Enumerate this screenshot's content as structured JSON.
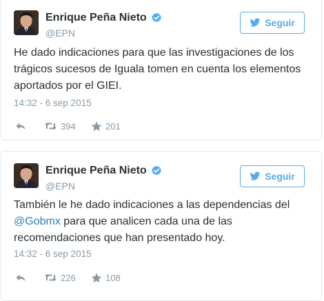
{
  "tweets": [
    {
      "author": {
        "name": "Enrique Peña Nieto",
        "handle": "@EPN",
        "verified": true
      },
      "follow_label": "Seguir",
      "text_before": "He dado indicaciones para que las investigaciones de los trágicos sucesos de Iguala tomen en cuenta los elementos aportados por el GIEI.",
      "mention": "",
      "text_after": "",
      "timestamp": "14:32 - 6 sep 2015",
      "retweets": "394",
      "favorites": "201"
    },
    {
      "author": {
        "name": "Enrique Peña Nieto",
        "handle": "@EPN",
        "verified": true
      },
      "follow_label": "Seguir",
      "text_before": "También le he dado indicaciones a las dependencias del ",
      "mention": "@Gobmx",
      "text_after": " para que analicen cada una de las recomendaciones que han presentado hoy.",
      "timestamp": "14:32 - 6 sep 2015",
      "retweets": "226",
      "favorites": "108"
    }
  ],
  "colors": {
    "brand_blue": "#55acee",
    "link_blue": "#2b7bb9",
    "muted_gray": "#8899a6",
    "text": "#292f33",
    "border": "#e1e8ed"
  },
  "icons": [
    "verified-badge-icon",
    "twitter-bird-icon",
    "reply-icon",
    "retweet-icon",
    "star-icon"
  ]
}
